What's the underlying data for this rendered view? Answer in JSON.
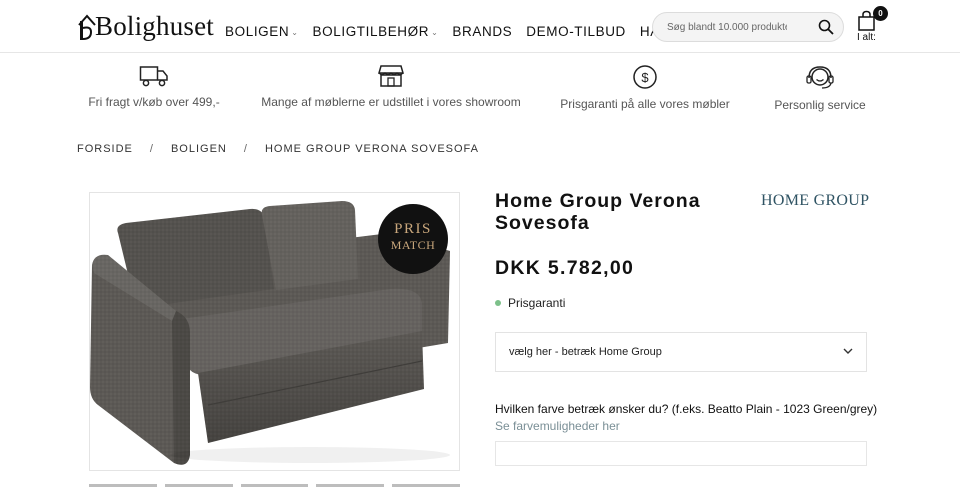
{
  "header": {
    "logo_text": "Bolighuset",
    "nav": [
      {
        "label": "BOLIGEN",
        "has_dropdown": true
      },
      {
        "label": "BOLIGTILBEHØR",
        "has_dropdown": true
      },
      {
        "label": "BRANDS",
        "has_dropdown": false
      },
      {
        "label": "DEMO-TILBUD",
        "has_dropdown": false
      },
      {
        "label": "HAVEN",
        "has_dropdown": false
      }
    ],
    "search": {
      "placeholder": "Søg blandt 10.000 produkter",
      "icon": "search-icon"
    },
    "cart": {
      "count": "0",
      "label": "I alt:",
      "icon": "shopping-bag-icon"
    }
  },
  "usps": [
    {
      "icon": "truck-icon",
      "text": "Fri fragt v/køb over 499,-"
    },
    {
      "icon": "store-icon",
      "text": "Mange af møblerne er udstillet i vores showroom"
    },
    {
      "icon": "dollar-coin-icon",
      "text": "Prisgaranti på alle vores møbler"
    },
    {
      "icon": "support-agent-icon",
      "text": "Personlig service"
    }
  ],
  "breadcrumb": [
    "FORSIDE",
    "BOLIGEN",
    "HOME GROUP VERONA SOVESOFA"
  ],
  "breadcrumb_separator": "/",
  "product": {
    "badge_line1": "PRIS",
    "badge_line2": "MATCH",
    "title": "Home Group Verona Sovesofa",
    "brand": "HOME GROUP",
    "price": "DKK 5.782,00",
    "status": "Prisgaranti",
    "status_color": "#7cc08a",
    "select_value": "vælg her - betræk Home Group",
    "question": "Hvilken farve betræk ønsker du? (f.eks. Beatto Plain - 1023 Green/grey)",
    "color_link": "Se farvemuligheder her"
  },
  "colors": {
    "brand_text": "#2f5363",
    "link": "#7a8f96",
    "badge_bg": "#111111",
    "badge_text": "#c9a77c"
  }
}
